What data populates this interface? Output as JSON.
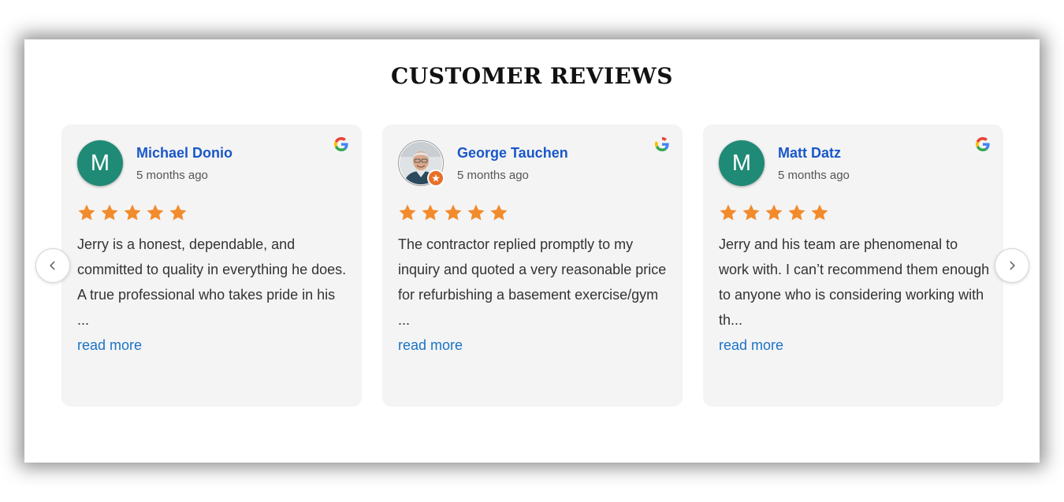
{
  "section": {
    "title": "CUSTOMER REVIEWS"
  },
  "colors": {
    "reviewer_name": "#1a57c9",
    "read_more": "#1a73c8",
    "star": "#f28b2c",
    "avatar_bg": "#1f8a75",
    "card_bg": "#f4f4f4"
  },
  "reviews": [
    {
      "initial": "M",
      "avatar_type": "initial",
      "name": "Michael Donio",
      "time": "5 months ago",
      "rating": 5,
      "source_icon": "google-icon",
      "text": "Jerry is a honest, dependable, and committed to quality in everything he does. A true professional who takes pride in his ...",
      "read_more": "read more"
    },
    {
      "initial": "",
      "avatar_type": "photo",
      "name": "George Tauchen",
      "time": "5 months ago",
      "rating": 5,
      "source_icon": "google-icon",
      "text": "The contractor replied promptly to my inquiry and quoted a very reasonable price for refurbishing a basement exercise/gym ...",
      "read_more": "read more"
    },
    {
      "initial": "M",
      "avatar_type": "initial",
      "name": "Matt Datz",
      "time": "5 months ago",
      "rating": 5,
      "source_icon": "google-icon",
      "text": "Jerry and his team are phenomenal to work with. I can’t recommend them enough to anyone who is considering working with th...",
      "read_more": "read more"
    }
  ],
  "nav": {
    "prev_icon": "chevron-left-icon",
    "next_icon": "chevron-right-icon"
  }
}
